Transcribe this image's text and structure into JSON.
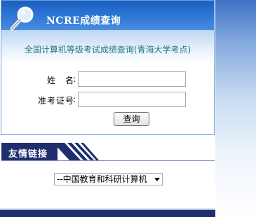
{
  "query_panel": {
    "title": "NCRE成绩查询",
    "subtitle": "全国计算机等级考试成绩查询(青海大学考点)",
    "name_label": "姓　名",
    "exam_id_label": "准考证号",
    "name_value": "",
    "exam_id_value": "",
    "search_label": "查询",
    "magnifier_icon": "magnifier-icon"
  },
  "links": {
    "title": "友情链接",
    "selected": "--中国教育和科研计算机"
  },
  "colors": {
    "header_blue": "#2f78d6",
    "subtitle_teal": "#1d7a87",
    "navy": "#1f2f6e"
  }
}
